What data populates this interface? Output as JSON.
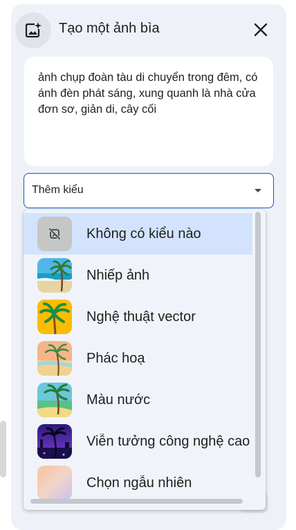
{
  "dialog": {
    "title": "Tạo một ảnh bìa",
    "header_icon": "image-sparkle-icon",
    "close_icon": "close-icon"
  },
  "prompt": {
    "text": "ảnh chụp đoàn tàu di chuyển trong đêm, có ánh đèn phát sáng, xung quanh là nhà cửa đơn sơ, giản di, cây cối"
  },
  "style_select": {
    "label": "Thêm kiểu",
    "icon": "dropdown-arrow-icon",
    "options": [
      {
        "label": "Không có kiểu nào",
        "icon": "no-style-icon",
        "selected": true
      },
      {
        "label": "Nhiếp ảnh",
        "icon": "photo-thumbnail"
      },
      {
        "label": "Nghệ thuật vector",
        "icon": "vector-thumbnail"
      },
      {
        "label": "Phác hoạ",
        "icon": "sketch-thumbnail"
      },
      {
        "label": "Màu nước",
        "icon": "watercolor-thumbnail"
      },
      {
        "label": "Viễn tưởng công nghệ cao",
        "icon": "scifi-thumbnail"
      },
      {
        "label": "Chọn ngẫu nhiên",
        "icon": "random-thumbnail"
      }
    ]
  },
  "colors": {
    "panel": "#eef2f8",
    "accent": "#0b57d0",
    "selected": "#d3e3fd",
    "dropdown": "#f0f4fa"
  }
}
